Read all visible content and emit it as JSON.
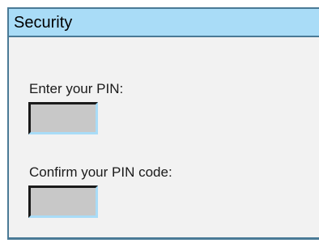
{
  "dialog": {
    "title": "Security",
    "pin_label": "Enter your PIN:",
    "pin_value": "",
    "confirm_label": "Confirm your PIN code:",
    "confirm_value": ""
  },
  "colors": {
    "titlebar_bg": "#a9dcf7",
    "dialog_border": "#4a7a96",
    "dialog_bg": "#f2f2f2",
    "field_bg": "#c8c8c8"
  }
}
